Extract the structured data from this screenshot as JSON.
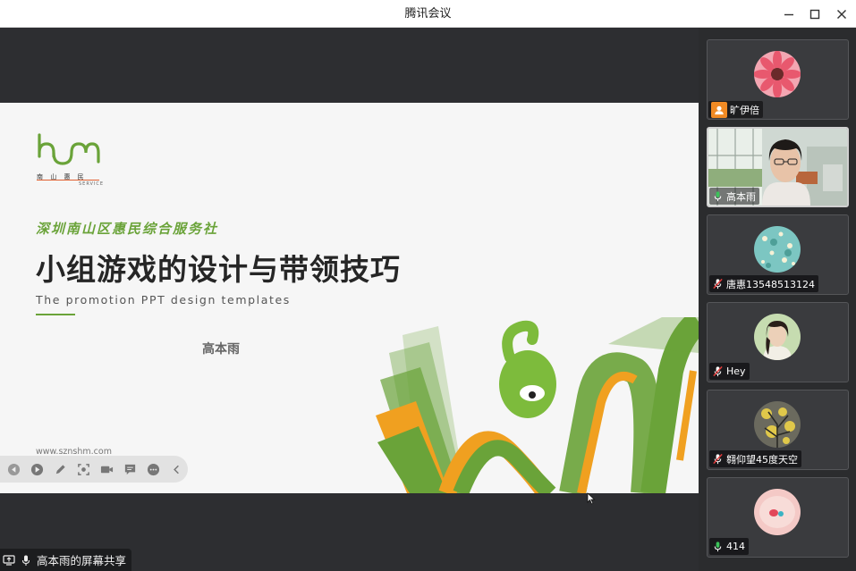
{
  "window": {
    "title": "腾讯会议"
  },
  "slide": {
    "org_name": "深圳南山区惠民综合服务社",
    "title": "小组游戏的设计与带领技巧",
    "subtitle": "The promotion PPT design templates",
    "presenter": "高本雨",
    "url": "www.sznshm.com",
    "logo_caption": "南  山  惠  民",
    "logo_sub": "SERVICE"
  },
  "share_status": {
    "label": "高本雨的屏幕共享",
    "icon": "screen-share-icon"
  },
  "toolbar": [
    "prev-icon",
    "play-icon",
    "pen-icon",
    "focus-icon",
    "camera-icon",
    "comment-icon",
    "more-icon",
    "collapse-icon"
  ],
  "participants": [
    {
      "name": "旷伊倍",
      "mic": "none",
      "type": "avatar",
      "badge": "user-icon"
    },
    {
      "name": "高本雨",
      "mic": "on",
      "type": "video"
    },
    {
      "name": "唐惠13548513124",
      "mic": "muted",
      "type": "avatar"
    },
    {
      "name": "Hey",
      "mic": "muted",
      "type": "avatar"
    },
    {
      "name": "翱仰望45度天空",
      "mic": "muted",
      "type": "avatar"
    },
    {
      "name": "414",
      "mic": "on",
      "type": "avatar"
    }
  ],
  "colors": {
    "brand_green": "#6aa339",
    "brand_orange": "#f0a020",
    "mic_green": "#3cc15a",
    "mute_red": "#e03a3a"
  }
}
